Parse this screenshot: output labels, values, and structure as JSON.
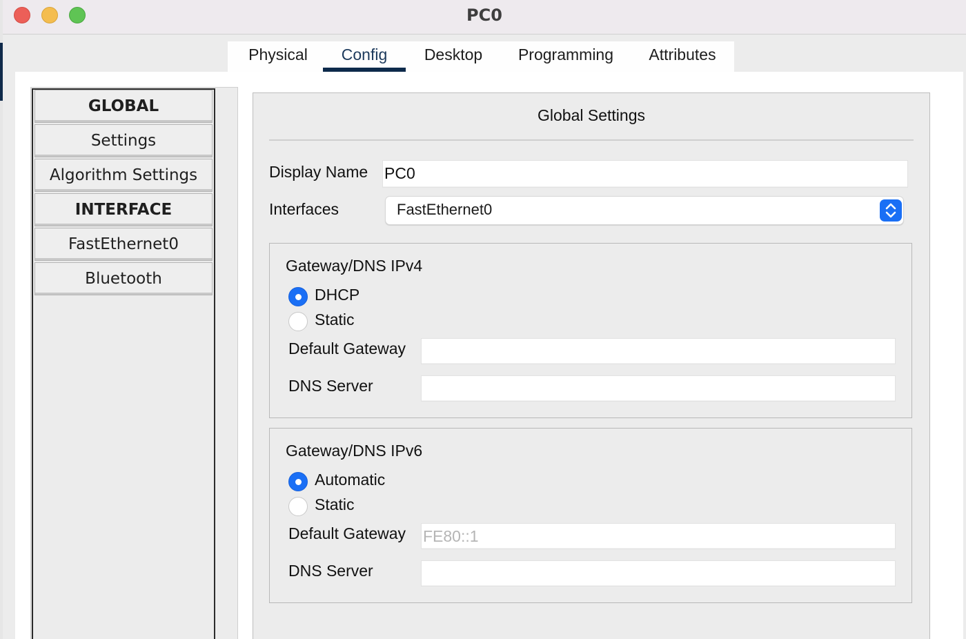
{
  "window": {
    "title": "PC0"
  },
  "tabs": [
    {
      "label": "Physical"
    },
    {
      "label": "Config"
    },
    {
      "label": "Desktop"
    },
    {
      "label": "Programming"
    },
    {
      "label": "Attributes"
    }
  ],
  "active_tab": "Config",
  "sidebar": {
    "items": [
      {
        "label": "GLOBAL",
        "type": "header"
      },
      {
        "label": "Settings",
        "type": "item"
      },
      {
        "label": "Algorithm Settings",
        "type": "item"
      },
      {
        "label": "INTERFACE",
        "type": "header"
      },
      {
        "label": "FastEthernet0",
        "type": "item"
      },
      {
        "label": "Bluetooth",
        "type": "item"
      }
    ]
  },
  "panel": {
    "title": "Global Settings",
    "display_name_label": "Display Name",
    "display_name_value": "PC0",
    "interfaces_label": "Interfaces",
    "interfaces_value": "FastEthernet0",
    "ipv4": {
      "title": "Gateway/DNS IPv4",
      "options": [
        "DHCP",
        "Static"
      ],
      "selected": "DHCP",
      "gateway_label": "Default Gateway",
      "gateway_value": "",
      "dns_label": "DNS Server",
      "dns_value": ""
    },
    "ipv6": {
      "title": "Gateway/DNS IPv6",
      "options": [
        "Automatic",
        "Static"
      ],
      "selected": "Automatic",
      "gateway_label": "Default Gateway",
      "gateway_value": "FE80::1",
      "dns_label": "DNS Server",
      "dns_value": ""
    }
  },
  "colors": {
    "accent": "#1a6ff5",
    "tab_underline": "#0d2a4b"
  }
}
